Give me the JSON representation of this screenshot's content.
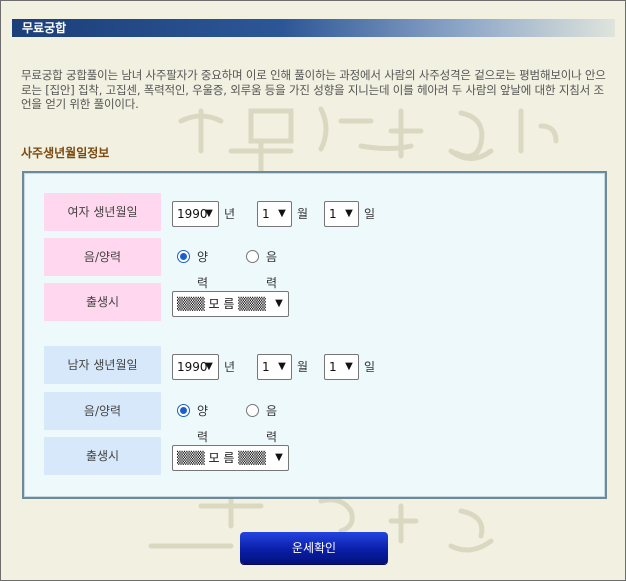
{
  "header": {
    "title": "무료궁합"
  },
  "intro": "무료궁합 궁합풀이는 남녀 사주팔자가 중요하며 이로 인해 풀이하는 과정에서 사람의 사주성격은 겉으로는 평범해보이나 안으로는 [집안] 집착, 고집센, 폭력적인, 우울증, 외루움 등을 가진 성향을 지니는데 이를 헤아려 두 사람의 앞날에 대한 지침서 조언을 얻기 위한 풀이이다.",
  "section_title": "사주생년월일정보",
  "female": {
    "birth_label": "여자 생년월일",
    "year": "1990",
    "month": "1",
    "day": "1",
    "calendar_label": "음/양력",
    "solar": "양력",
    "lunar": "음력",
    "selected": "solar",
    "time_label": "출생시",
    "time_value": "▒▒▒ 모 름 ▒▒▒"
  },
  "male": {
    "birth_label": "남자 생년월일",
    "year": "1990",
    "month": "1",
    "day": "1",
    "calendar_label": "음/양력",
    "solar": "양력",
    "lunar": "음력",
    "selected": "solar",
    "time_label": "출생시",
    "time_value": "▒▒▒ 모 름 ▒▒▒"
  },
  "units": {
    "year": "년",
    "month": "월",
    "day": "일"
  },
  "submit_label": "운세확인",
  "icons": {
    "dropdown": "chevron-down-icon"
  },
  "colors": {
    "title_bar": "#1b3f7a",
    "female_label_bg": "#ffd8ef",
    "male_label_bg": "#d8e8fb",
    "panel_bg": "#eef9fb",
    "button": "#0a1ea8",
    "section_title": "#7a4a10"
  }
}
